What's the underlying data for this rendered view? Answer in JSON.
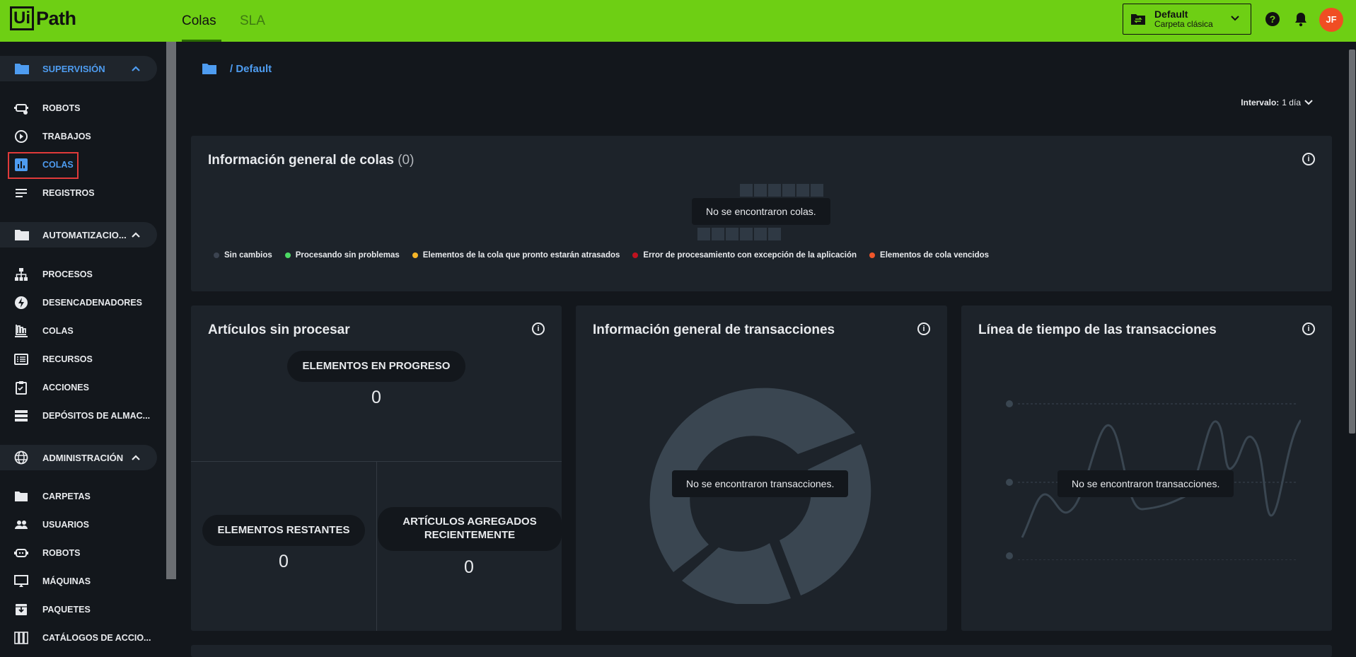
{
  "topbar": {
    "logo_ui": "Ui",
    "logo_path": "Path",
    "tabs": [
      {
        "label": "Colas"
      },
      {
        "label": "SLA"
      }
    ],
    "folder_name": "Default",
    "folder_type": "Carpeta clásica",
    "avatar": "JF",
    "colors": {
      "bg": "#6ecf14",
      "avatar": "#f04e23"
    }
  },
  "sidebar": {
    "sections": [
      {
        "label": "SUPERVISIÓN",
        "icon": "folder-icon"
      },
      {
        "label": "AUTOMATIZACIO...",
        "icon": "folder-icon"
      },
      {
        "label": "ADMINISTRACIÓN",
        "icon": "globe-icon"
      }
    ],
    "items": [
      {
        "label": "ROBOTS",
        "icon": "robot-icon"
      },
      {
        "label": "TRABAJOS",
        "icon": "play-icon"
      },
      {
        "label": "COLAS",
        "icon": "bar-chart-icon",
        "active": true
      },
      {
        "label": "REGISTROS",
        "icon": "lines-icon"
      },
      {
        "label": "PROCESOS",
        "icon": "hierarchy-icon"
      },
      {
        "label": "DESENCADENADORES",
        "icon": "bolt-icon"
      },
      {
        "label": "COLAS",
        "icon": "stack-icon"
      },
      {
        "label": "RECURSOS",
        "icon": "list-icon"
      },
      {
        "label": "ACCIONES",
        "icon": "clipboard-icon"
      },
      {
        "label": "DEPÓSITOS DE ALMAC...",
        "icon": "storage-icon"
      },
      {
        "label": "CARPETAS",
        "icon": "folder-icon"
      },
      {
        "label": "USUARIOS",
        "icon": "users-icon"
      },
      {
        "label": "ROBOTS",
        "icon": "robot-icon"
      },
      {
        "label": "MÁQUINAS",
        "icon": "monitor-icon"
      },
      {
        "label": "PAQUETES",
        "icon": "package-icon"
      },
      {
        "label": "CATÁLOGOS DE ACCIO...",
        "icon": "books-icon"
      }
    ]
  },
  "breadcrumb": {
    "text": "/ Default"
  },
  "interval": {
    "label": "Intervalo:",
    "value": "1 día"
  },
  "overview": {
    "title": "Información general de colas",
    "count": "(0)",
    "empty_msg": "No se encontraron colas.",
    "legend": [
      {
        "label": "Sin cambios",
        "color": "#3b4350"
      },
      {
        "label": "Procesando sin problemas",
        "color": "#4cd964"
      },
      {
        "label": "Elementos de la cola que pronto estarán atrasados",
        "color": "#f5b528"
      },
      {
        "label": "Error de procesamiento con excepción de la aplicación",
        "color": "#c0121f"
      },
      {
        "label": "Elementos de cola vencidos",
        "color": "#f0562a"
      }
    ]
  },
  "unprocessed": {
    "title": "Artículos sin procesar",
    "in_progress_label": "ELEMENTOS EN PROGRESO",
    "in_progress_value": "0",
    "remaining_label": "ELEMENTOS RESTANTES",
    "remaining_value": "0",
    "recent_label_1": "ARTÍCULOS AGREGADOS",
    "recent_label_2": "RECIENTEMENTE",
    "recent_value": "0"
  },
  "transactions": {
    "title": "Información general de transacciones",
    "empty_msg": "No se encontraron transacciones."
  },
  "timeline": {
    "title": "Línea de tiempo de las transacciones",
    "empty_msg": "No se encontraron transacciones."
  }
}
